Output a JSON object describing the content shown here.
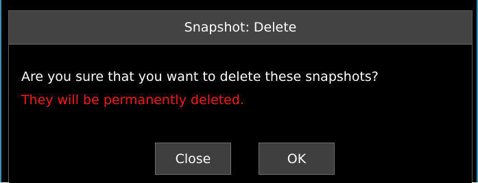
{
  "dialog": {
    "title": "Snapshot: Delete",
    "question": "Are you sure that you want to delete these snapshots?",
    "warning": "They will be permanently deleted.",
    "buttons": {
      "close_label": "Close",
      "ok_label": "OK"
    }
  },
  "colors": {
    "warning_text": "#ff1a1a",
    "title_bar": "#434343",
    "background": "#000000",
    "frame_accent": "#3a92b6"
  }
}
